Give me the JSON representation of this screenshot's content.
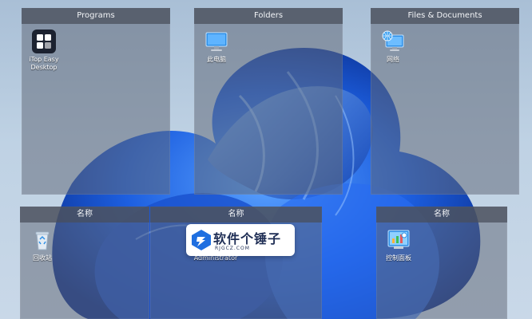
{
  "fences": [
    {
      "title": "Programs",
      "items": [
        {
          "label": "iTop Easy\nDesktop",
          "icon": "itop-easy-desktop-icon"
        }
      ]
    },
    {
      "title": "Folders",
      "items": [
        {
          "label": "此电脑",
          "icon": "this-pc-icon"
        }
      ]
    },
    {
      "title": "Files & Documents",
      "items": [
        {
          "label": "网络",
          "icon": "network-icon"
        }
      ]
    },
    {
      "title": "名称",
      "items": [
        {
          "label": "回收站",
          "icon": "recycle-bin-icon"
        }
      ]
    },
    {
      "title": "名称",
      "items": [
        {
          "label": "Administrator",
          "icon": "user-folder-icon"
        }
      ]
    },
    {
      "title": "名称",
      "items": [
        {
          "label": "控制面板",
          "icon": "control-panel-icon"
        }
      ]
    }
  ],
  "watermark": {
    "main": "软件个锤子",
    "sub": "RJGCZ.COM"
  },
  "colors": {
    "wallpaper_blue": "#1b5fd6",
    "fence_bg": "#606876",
    "fence_title_bg": "#484e5a"
  }
}
